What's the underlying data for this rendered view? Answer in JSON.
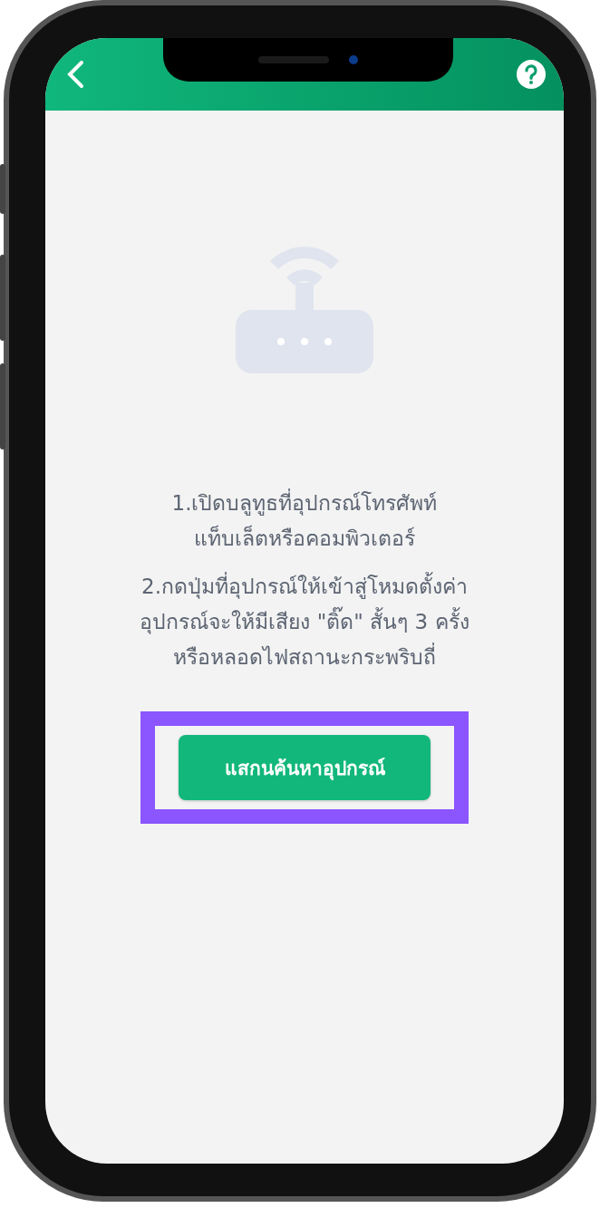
{
  "instructions": [
    "1.เปิดบลูทูธที่อุปกรณ์โทรศัพท์\nแท็บเล็ตหรือคอมพิวเตอร์",
    "2.กดปุ่มที่อุปกรณ์ให้เข้าสู่โหมดตั้งค่า\nอุปกรณ์จะให้มีเสียง \"ติ๊ด\" สั้นๆ 3 ครั้ง\nหรือหลอดไฟสถานะกระพริบถี่"
  ],
  "scan_button": {
    "label": "แสกนค้นหาอุปกรณ์",
    "highlighted": true
  }
}
